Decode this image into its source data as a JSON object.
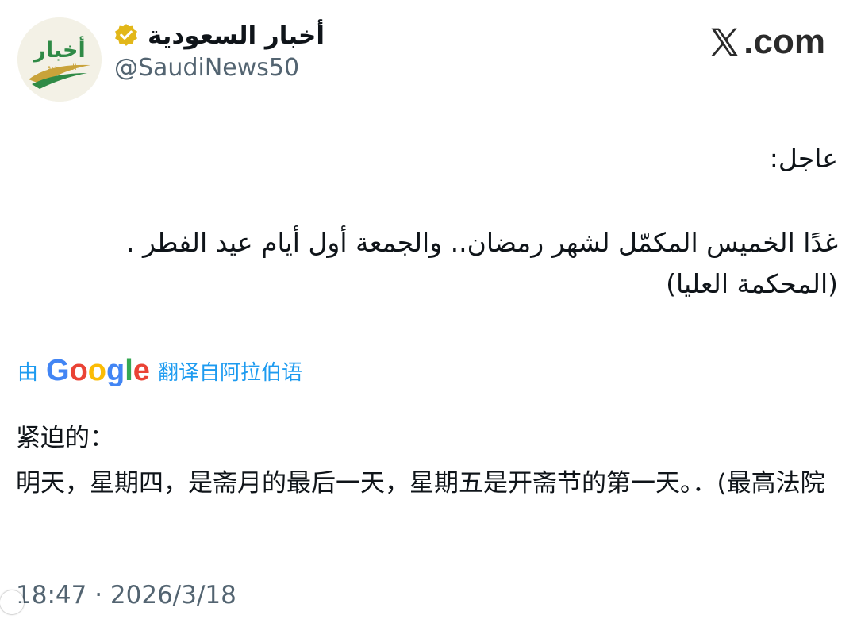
{
  "account": {
    "display_name": "أخبار السعودية",
    "handle": "@SaudiNews50",
    "avatar_icon": "saudi-news-logo",
    "avatar_logo_text": "أخبار",
    "avatar_logo_subtext": "السعودية",
    "verified_icon": "verified-badge-icon",
    "verified_color": "#e2b719"
  },
  "site": {
    "label": ".com",
    "logo_icon": "x-logo-icon"
  },
  "tweet": {
    "arabic_urgent": "عاجل:",
    "arabic_line1": "غدًا الخميس المكمّل لشهر رمضان.. والجمعة أول أيام عيد الفطر .",
    "arabic_line2": "(المحكمة العليا)"
  },
  "translation": {
    "prefix": "由",
    "google": [
      "G",
      "o",
      "o",
      "g",
      "l",
      "e"
    ],
    "google_colors": [
      "#4285f4",
      "#ea4335",
      "#fbbc05",
      "#4285f4",
      "#34a853",
      "#ea4335"
    ],
    "suffix": "翻译自阿拉伯语",
    "title": "紧迫的：",
    "body": "明天，星期四，是斋月的最后一天，星期五是开斋节的第一天。．(最高法院"
  },
  "meta": {
    "timestamp": "18:47 · 2026/3/18"
  },
  "colors": {
    "link": "#1d9bf0",
    "secondary_text": "#536471",
    "primary_text": "#0f1419"
  }
}
